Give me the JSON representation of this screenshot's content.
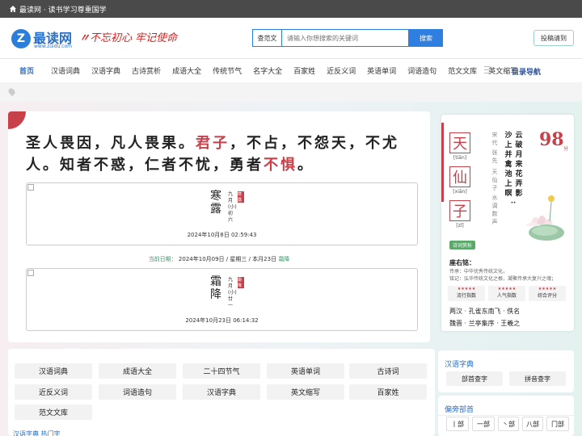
{
  "topbar": {
    "text": "最读网 · 读书学习尊重国学"
  },
  "logo": {
    "letter": "Z",
    "name": "最读网",
    "url": "www.zuidu.com"
  },
  "slogan": {
    "text": "不忘初心 牢记使命"
  },
  "search": {
    "scope": "查范文",
    "placeholder": "请输入你想搜索的关键词",
    "button": "搜索"
  },
  "submit_button": "投稿请到",
  "nav": {
    "items": [
      "首页",
      "汉语词典",
      "汉语字典",
      "古诗赏析",
      "成语大全",
      "传统节气",
      "名字大全",
      "百家姓",
      "近反义词",
      "英语单词",
      "词语造句",
      "范文文库",
      "英文缩写"
    ],
    "directory": "目录导航"
  },
  "quote": {
    "parts": [
      {
        "t": "圣人畏因，凡人畏果。",
        "hl": false
      },
      {
        "t": "君子",
        "hl": true
      },
      {
        "t": "，不占，不怨天，不尤人。知者不惑，仁者不忧，勇者",
        "hl": false
      },
      {
        "t": "不惧",
        "hl": true
      },
      {
        "t": "。",
        "hl": false
      }
    ]
  },
  "solar_terms": [
    {
      "name": "寒露",
      "lunar": "九月(小)初六",
      "seal": "寒露",
      "time": "2024年10月8日 02:59:43"
    },
    {
      "name": "霜降",
      "lunar": "九月(小)廿一",
      "seal": "霜降",
      "time": "2024年10月23日 06:14:32"
    }
  ],
  "today": {
    "label": "当前日期：",
    "date": "2024年10月09日 / 星期三 / 本月23日",
    "term": "霜降"
  },
  "poem": {
    "chars": [
      {
        "c": "天",
        "py": "[tiān]"
      },
      {
        "c": "仙",
        "py": "[xiān]"
      },
      {
        "c": "子",
        "py": "[zǐ]"
      }
    ],
    "dynasty": "宋代",
    "author": "张先",
    "cipai": "天仙子",
    "subtitle": "水调数声",
    "lines": [
      {
        "t": "云破月来花弄影",
        "red": false
      },
      {
        "t": "沙上并禽池上瞑",
        "red": false
      },
      {
        "t": "··",
        "red": false
      }
    ],
    "score": "98",
    "score_unit": "分",
    "tag": "诗词赏析",
    "motto_title": "座右铭：",
    "motto_lines": [
      "传承：中华优秀传统文化，",
      "铭记：弘华传统文化之根，凝聚传承大复兴之魂；"
    ],
    "ratings": [
      {
        "stars": "★★★★★",
        "label": "流行指数"
      },
      {
        "stars": "★★★★★",
        "label": "人气指数"
      },
      {
        "stars": "★★★★★",
        "label": "综合评分"
      }
    ],
    "related": [
      "两汉 · 孔雀东南飞 · 佚名",
      "魏晋 · 兰亭集序 · 王羲之"
    ]
  },
  "categories": {
    "buttons": [
      "汉语词典",
      "成语大全",
      "二十四节气",
      "英语单词",
      "古诗词",
      "近反义词",
      "词语造句",
      "汉语字典",
      "英文缩写",
      "百家姓",
      "范文文库"
    ],
    "hot": "汉语字典 热门字"
  },
  "zidian": {
    "title": "汉语字典",
    "buttons": [
      "部首查字",
      "拼音查字"
    ]
  },
  "bushou": {
    "title": "偏旁部首",
    "buttons": [
      "丨部",
      "一部",
      "丶部",
      "八部",
      "冂部"
    ]
  },
  "colors": {
    "accent": "#c8414a",
    "brand": "#2b6fc4",
    "green": "#3a9a6e"
  }
}
